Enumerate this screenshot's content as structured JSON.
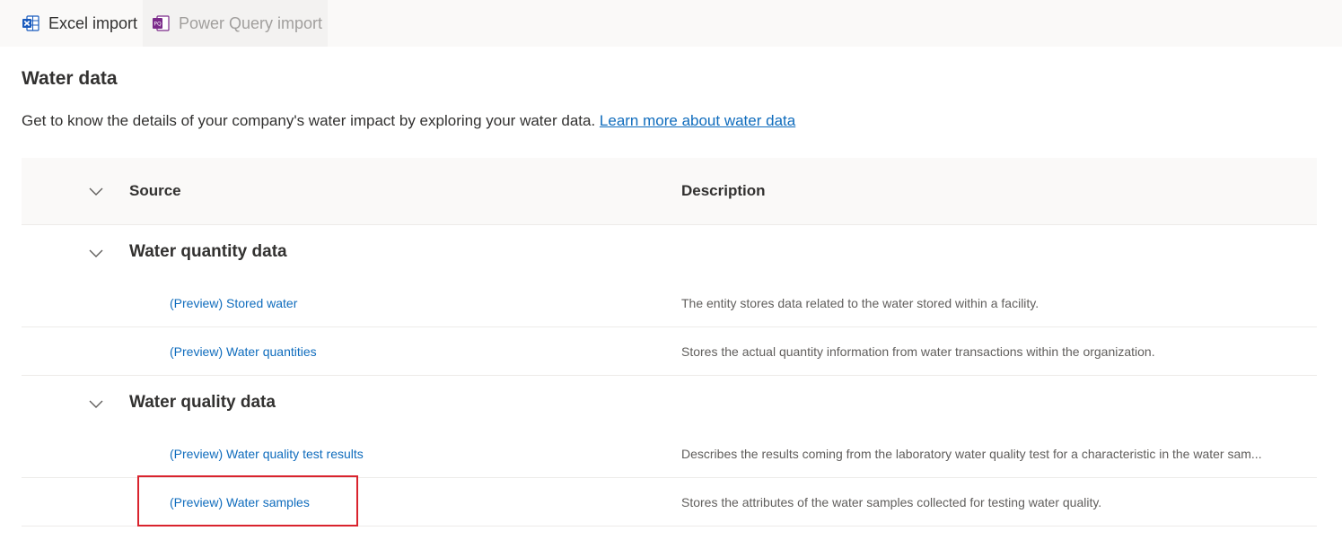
{
  "tabs": [
    {
      "label": "Excel import",
      "icon": "excel-icon",
      "active": true
    },
    {
      "label": "Power Query import",
      "icon": "power-query-icon",
      "active": false
    }
  ],
  "page": {
    "title": "Water data",
    "intro_text": "Get to know the details of your company's water impact by exploring your water data.",
    "learn_more_link": "Learn more about water data"
  },
  "table": {
    "columns": {
      "source": "Source",
      "description": "Description"
    },
    "groups": [
      {
        "title": "Water quantity data",
        "items": [
          {
            "link": "(Preview) Stored water",
            "description": "The entity stores data related to the water stored within a facility."
          },
          {
            "link": "(Preview) Water quantities",
            "description": "Stores the actual quantity information from water transactions within the organization."
          }
        ]
      },
      {
        "title": "Water quality data",
        "items": [
          {
            "link": "(Preview) Water quality test results",
            "description": "Describes the results coming from the laboratory water quality test for a characteristic in the water sam..."
          },
          {
            "link": "(Preview) Water samples",
            "description": "Stores the attributes of the water samples collected for testing water quality."
          }
        ]
      }
    ]
  },
  "colors": {
    "link": "#0f6cbd",
    "highlight_box": "#d9232d",
    "excel_green": "#217346",
    "power_query_purple": "#7b2a8a"
  }
}
